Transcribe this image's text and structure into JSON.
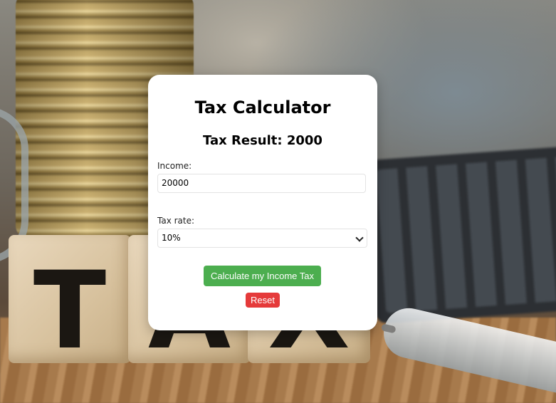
{
  "calculator": {
    "title": "Tax Calculator",
    "result_text": "Tax Result: 2000",
    "income_label": "Income:",
    "income_value": "20000",
    "tax_rate_label": "Tax rate:",
    "tax_rate_selected": "10%",
    "calculate_button": "Calculate my Income Tax",
    "reset_button": "Reset"
  },
  "background": {
    "block_letters": [
      "T",
      "A",
      "X"
    ]
  },
  "colors": {
    "card_background": "#ffffff",
    "calculate_button": "#4cae4f",
    "reset_button": "#e53a3a"
  },
  "icons": {
    "select_arrow": "chevron-down-icon"
  }
}
